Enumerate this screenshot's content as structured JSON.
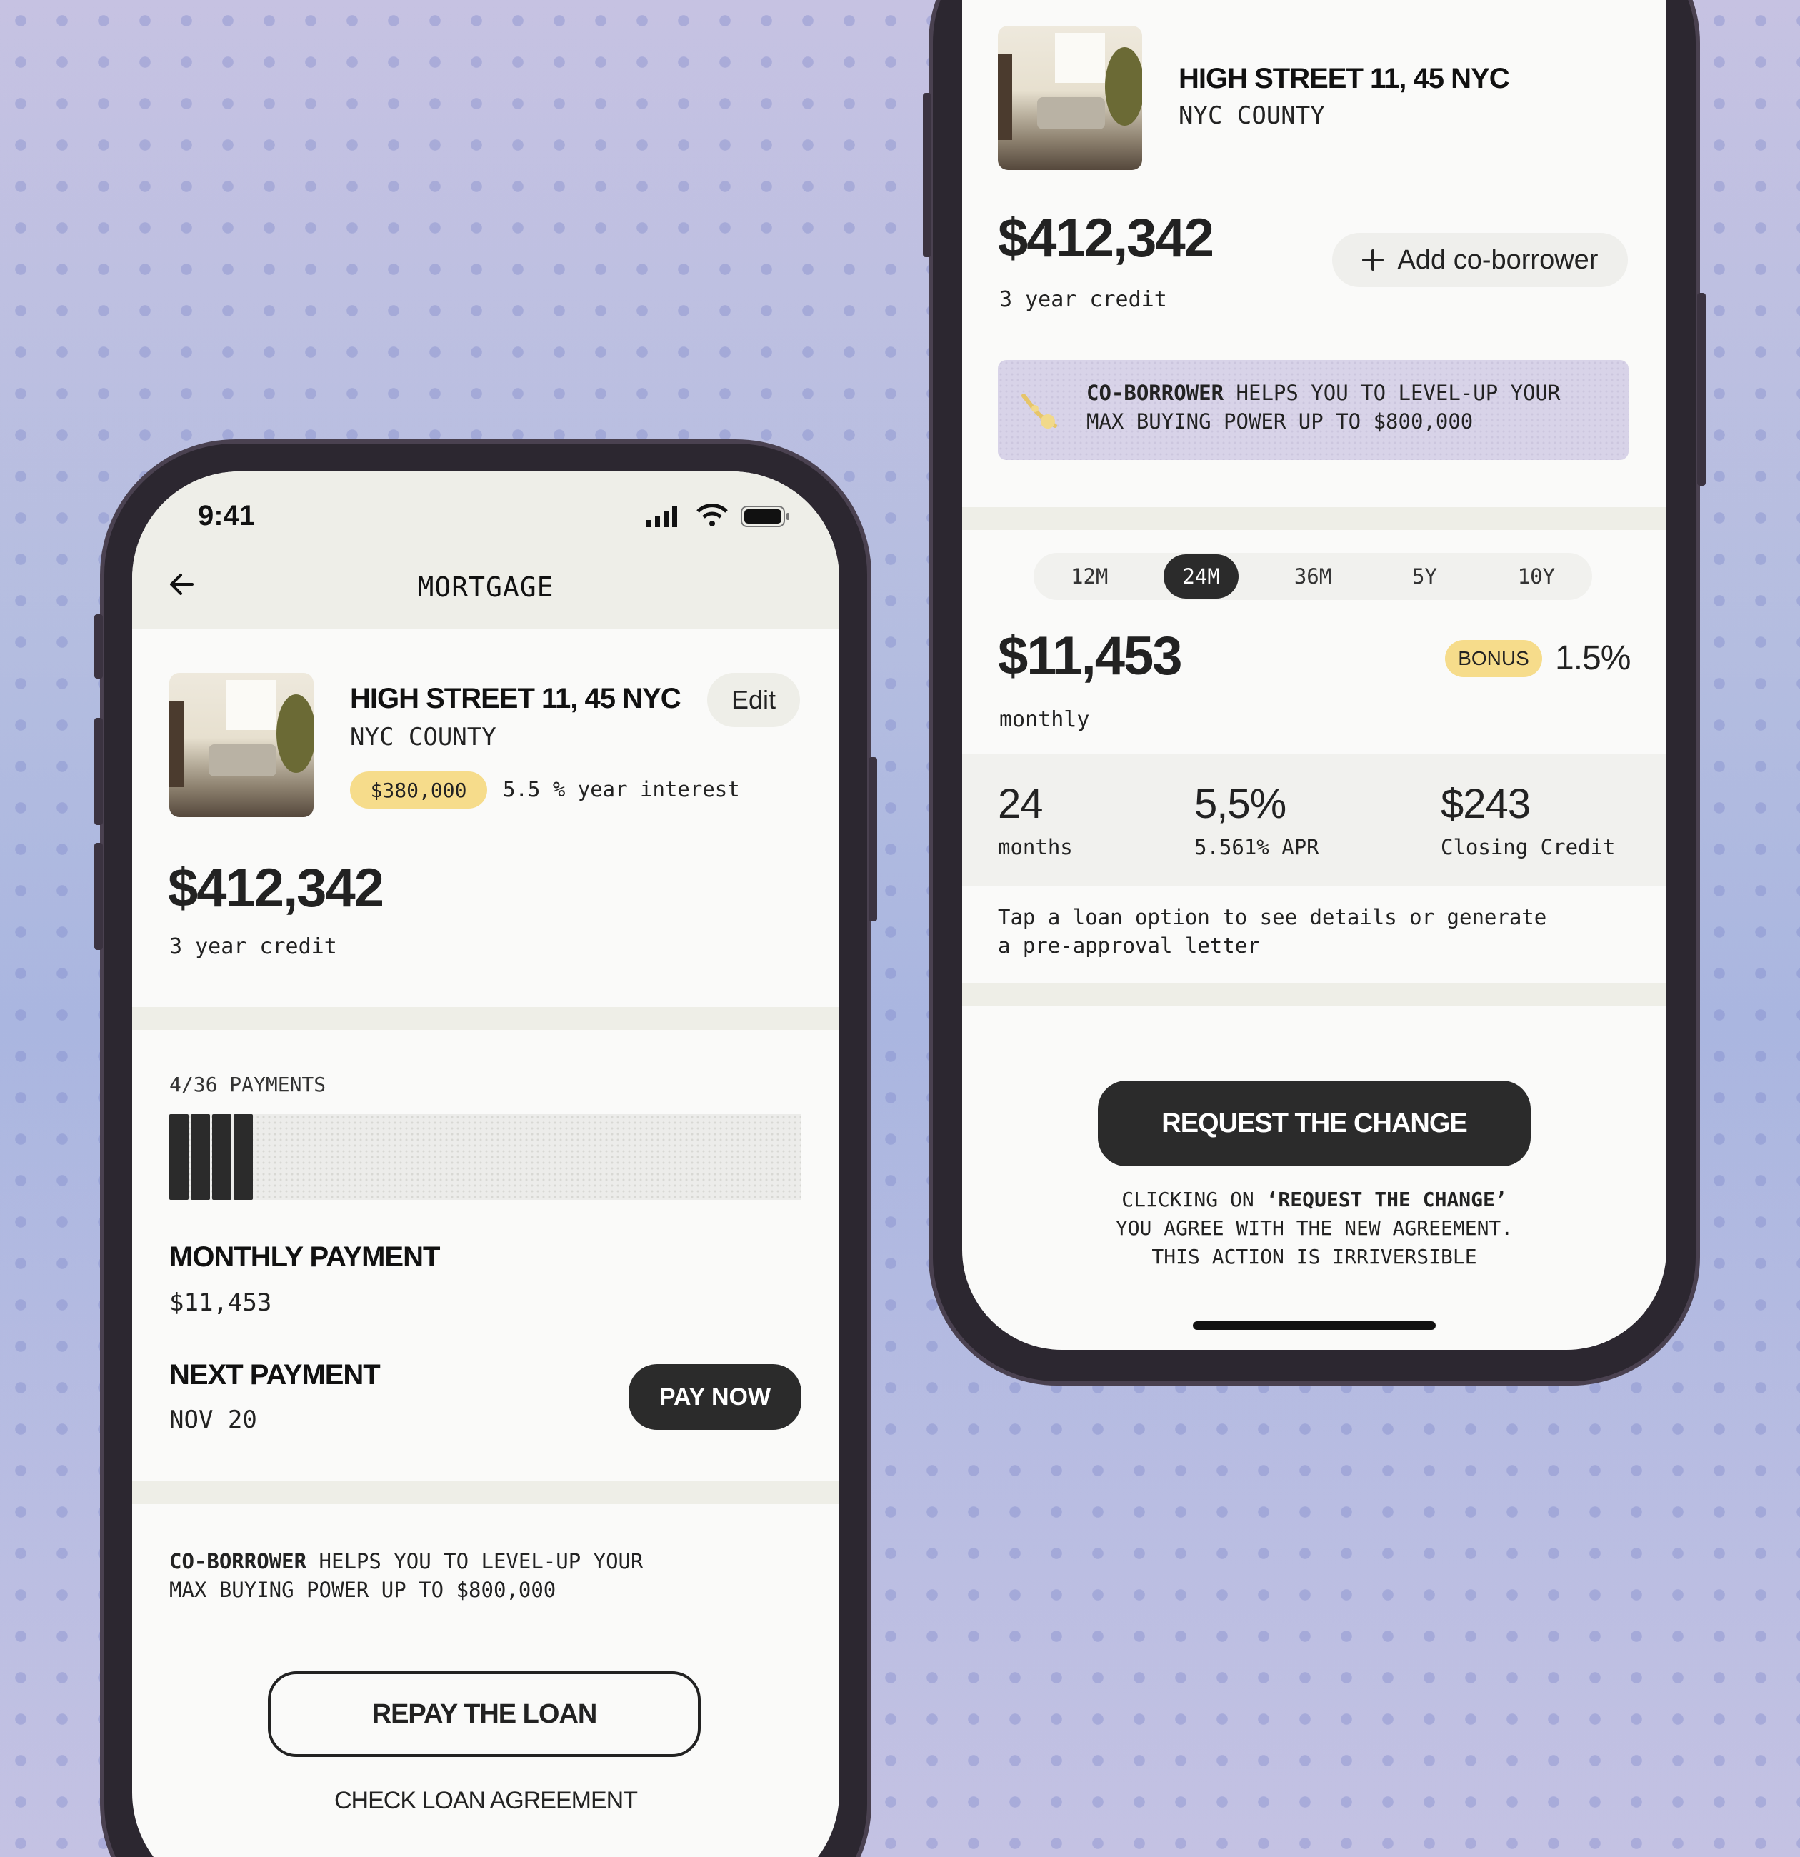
{
  "left": {
    "status": {
      "time": "9:41"
    },
    "nav": {
      "title": "MORTGAGE"
    },
    "property": {
      "name": "HIGH STREET 11, 45 NYC",
      "county": "NYC COUNTY",
      "edit_label": "Edit",
      "price_badge": "$380,000",
      "interest": "5.5 % year interest"
    },
    "credit": {
      "amount": "$412,342",
      "term": "3 year credit"
    },
    "payments": {
      "label": "4/36 PAYMENTS",
      "paid": 4,
      "total": 36
    },
    "monthly": {
      "heading": "MONTHLY PAYMENT",
      "value": "$11,453"
    },
    "next": {
      "heading": "NEXT PAYMENT",
      "value": "NOV 20",
      "button": "PAY NOW"
    },
    "coborrower": {
      "bold": "CO-BORROWER",
      "text1": " HELPS YOU TO LEVEL-UP YOUR",
      "text2": "MAX BUYING POWER UP TO $800,000"
    },
    "actions": {
      "repay": "REPAY THE LOAN",
      "agreement": "CHECK LOAN AGREEMENT"
    }
  },
  "right": {
    "property": {
      "name": "HIGH STREET 11, 45 NYC",
      "county": "NYC COUNTY"
    },
    "credit": {
      "amount": "$412,342",
      "term": "3 year credit",
      "add_button": "Add co-borrower"
    },
    "banner": {
      "bold": "CO-BORROWER",
      "text1": " HELPS YOU TO LEVEL-UP YOUR",
      "text2": "MAX BUYING POWER UP TO $800,000"
    },
    "terms": {
      "tabs": [
        "12M",
        "24M",
        "36M",
        "5Y",
        "10Y"
      ],
      "selected": "24M"
    },
    "monthly": {
      "amount": "$11,453",
      "label": "monthly",
      "bonus_badge": "BONUS",
      "bonus_value": "1.5%"
    },
    "stats": [
      {
        "value": "24",
        "label": "months"
      },
      {
        "value": "5,5%",
        "label": "5.561% APR"
      },
      {
        "value": "$243",
        "label": "Closing Credit"
      }
    ],
    "hint": {
      "line1": "Tap a loan option to see details or generate",
      "line2": "a pre-approval letter"
    },
    "request": {
      "button": "REQUEST THE CHANGE",
      "line1_pre": "CLICKING ON ",
      "line1_bold": "‘REQUEST THE CHANGE’",
      "line2": "YOU AGREE WITH THE NEW AGREEMENT.",
      "line3": "THIS ACTION IS IRRIVERSIBLE"
    }
  },
  "colors": {
    "dark": "#2b2b2b",
    "yellow_badge": "#f6dc8b",
    "band": "#eeeee7",
    "banner_lilac": "#d8d3e8",
    "background": "#b9bde0"
  }
}
